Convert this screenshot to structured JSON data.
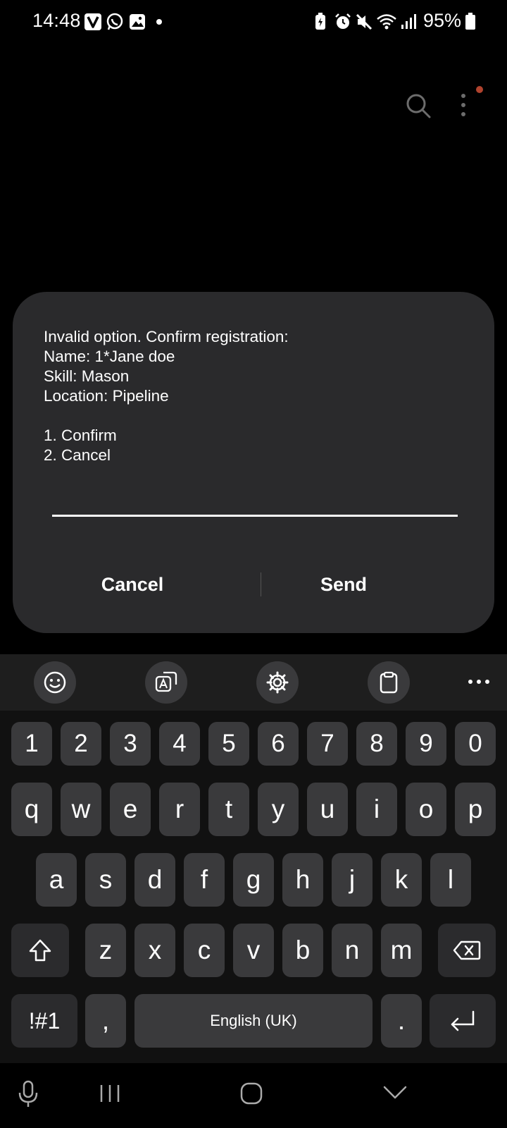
{
  "status_bar": {
    "time": "14:48",
    "battery_percent": "95%",
    "left_icons": [
      "v-app-icon",
      "whatsapp-icon",
      "gallery-icon",
      "dot-indicator"
    ],
    "right_icons": [
      "battery-saver-icon",
      "alarm-icon",
      "mute-icon",
      "wifi-icon",
      "signal-icon",
      "battery-icon"
    ]
  },
  "top_bar": {
    "icons": [
      "search-icon",
      "more-options-icon"
    ],
    "notification_dot_color": "#b0432e"
  },
  "dialog": {
    "message": "Invalid option. Confirm registration:\nName: 1*Jane doe\nSkill: Mason\nLocation: Pipeline\n\n1. Confirm\n2. Cancel",
    "input_value": "",
    "cancel_label": "Cancel",
    "send_label": "Send",
    "background_color": "#2a2a2c"
  },
  "keyboard": {
    "toolbar_icons": [
      "emoji-icon",
      "translate-icon",
      "settings-icon",
      "clipboard-icon",
      "more-icon"
    ],
    "number_row": [
      "1",
      "2",
      "3",
      "4",
      "5",
      "6",
      "7",
      "8",
      "9",
      "0"
    ],
    "row1": [
      "q",
      "w",
      "e",
      "r",
      "t",
      "y",
      "u",
      "i",
      "o",
      "p"
    ],
    "row2": [
      "a",
      "s",
      "d",
      "f",
      "g",
      "h",
      "j",
      "k",
      "l"
    ],
    "row3": [
      "z",
      "x",
      "c",
      "v",
      "b",
      "n",
      "m"
    ],
    "symbols_label": "!#1",
    "comma_label": ",",
    "space_label": "English (UK)",
    "period_label": "."
  },
  "nav_bar": {
    "icons": [
      "microphone-icon",
      "recents-icon",
      "home-icon",
      "hide-keyboard-icon"
    ]
  }
}
